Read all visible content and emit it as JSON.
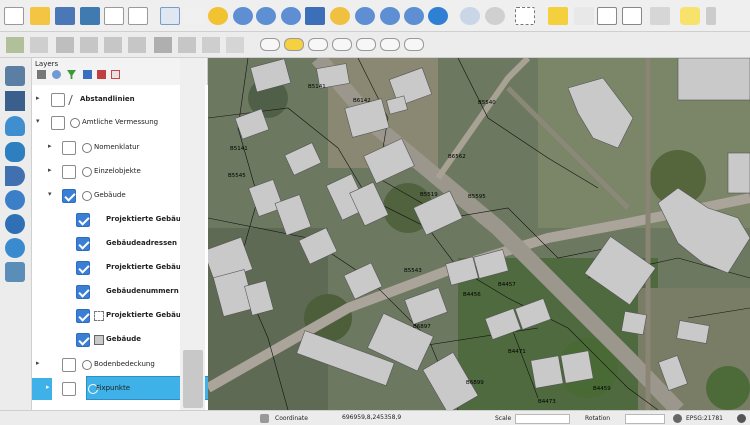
{
  "layers_panel": {
    "title": "Layers",
    "items": [
      {
        "label": "Abstandlinien",
        "checked": false
      },
      {
        "label": "Amtliche Vermessung",
        "checked": false
      },
      {
        "label": "Nomenklatur",
        "checked": false
      },
      {
        "label": "Einzelobjekte",
        "checked": false
      },
      {
        "label": "Gebäude",
        "checked": true
      },
      {
        "label": "Projektierte Gebäudes...",
        "checked": true
      },
      {
        "label": "Gebäudeadressen",
        "checked": true
      },
      {
        "label": "Projektierte Gebäuden...",
        "checked": true
      },
      {
        "label": "Gebäudenummern",
        "checked": true
      },
      {
        "label": "Projektierte Gebäude",
        "checked": true
      },
      {
        "label": "Gebäude",
        "checked": true
      },
      {
        "label": "Bodenbedeckung",
        "checked": false
      },
      {
        "label": "Fixpunkte",
        "checked": false
      }
    ]
  },
  "statusbar": {
    "coordinate_label": "Coordinate",
    "coordinate_value": "696959,8,245358,9",
    "scale_label": "Scale",
    "rotation_label": "Rotation",
    "crs_label": "EPSG:21781"
  },
  "map": {
    "parcel_labels": [
      "B5141",
      "B6142",
      "B5540",
      "B5141",
      "B5545",
      "B5519",
      "B6562",
      "B5543",
      "B5595",
      "B6897",
      "B4456",
      "B4457",
      "B4471",
      "B4473",
      "B6899",
      "B4459"
    ],
    "building_numbers": [
      "3095",
      "3217",
      "3209",
      "3031",
      "3209",
      "3216",
      "3230",
      "3224",
      "3225",
      "3227",
      "3229",
      "2195",
      "4139",
      "3111"
    ]
  }
}
